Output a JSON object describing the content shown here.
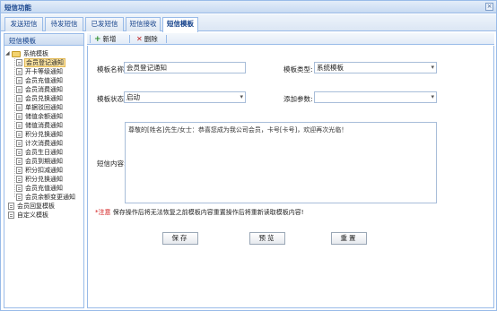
{
  "window": {
    "title": "短信功能"
  },
  "tabs": [
    {
      "label": "发送短信"
    },
    {
      "label": "待发短信"
    },
    {
      "label": "已发短信"
    },
    {
      "label": "短信接收"
    },
    {
      "label": "短信模板"
    }
  ],
  "sidebar": {
    "header": "短信模板",
    "tree": {
      "root_label": "系统模板",
      "children": [
        "会员登记通知",
        "开卡等级通知",
        "会员充值通知",
        "会员消费通知",
        "会员兑换通知",
        "单据驳回通知",
        "储值余额通知",
        "储值消费通知",
        "积分兑换通知",
        "计次消费通知",
        "会员生日通知",
        "会员到期通知",
        "积分扣减通知",
        "积分兑换通知",
        "会员充值通知",
        "会员余额变更通知"
      ],
      "other_roots": [
        "会员回复模板",
        "自定义模板"
      ]
    }
  },
  "toolbar": {
    "add_label": "新增",
    "delete_label": "删除"
  },
  "form": {
    "name_label": "模板名称:",
    "name_value": "会员登记通知",
    "type_label": "模板类型:",
    "type_value": "系统模板",
    "status_label": "模板状态:",
    "status_value": "启动",
    "param_label": "添加参数:",
    "param_value": "",
    "content_label": "短信内容:",
    "content_value": "尊敬的[姓名]先生/女士：恭喜您成为我公司会员，卡号[卡号]，欢迎再次光临！",
    "note_prefix": "*注意",
    "note_text": "保存操作后将无法恢复之前模板内容重置操作后将重新读取模板内容!"
  },
  "buttons": {
    "save": "保存",
    "preview": "预览",
    "reset": "重置"
  }
}
